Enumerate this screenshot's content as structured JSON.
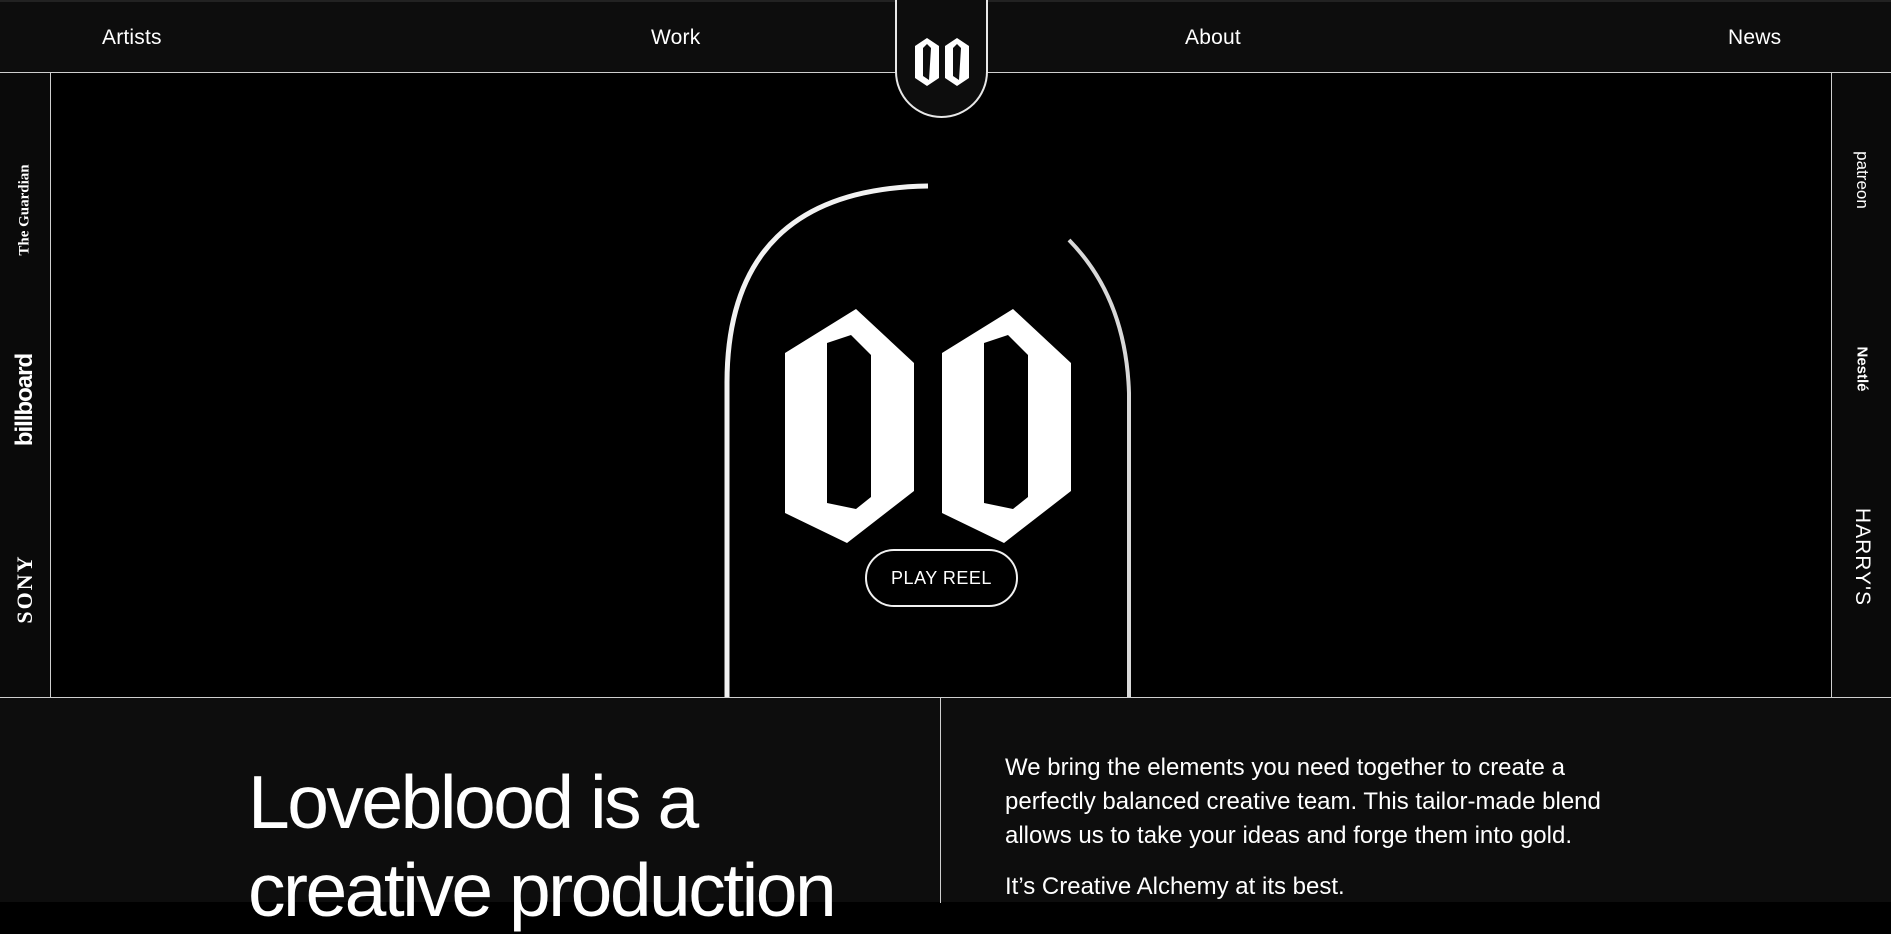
{
  "nav": {
    "artists": "Artists",
    "work": "Work",
    "about": "About",
    "news": "News",
    "logo": "00"
  },
  "left_brands": [
    "The Guardian",
    "billboard",
    "SONY"
  ],
  "right_brands": [
    "patreon",
    "Nestlé",
    "HARRY'S"
  ],
  "hero": {
    "play_label": "PLAY REEL"
  },
  "intro": {
    "headline_line1": "Loveblood is a",
    "headline_line2": "creative production",
    "paragraph": "We bring the elements you need together to create a perfectly balanced creative team. This tailor-made blend allows us to take your ideas and forge them into gold.",
    "tagline": "It’s Creative Alchemy at its best."
  }
}
